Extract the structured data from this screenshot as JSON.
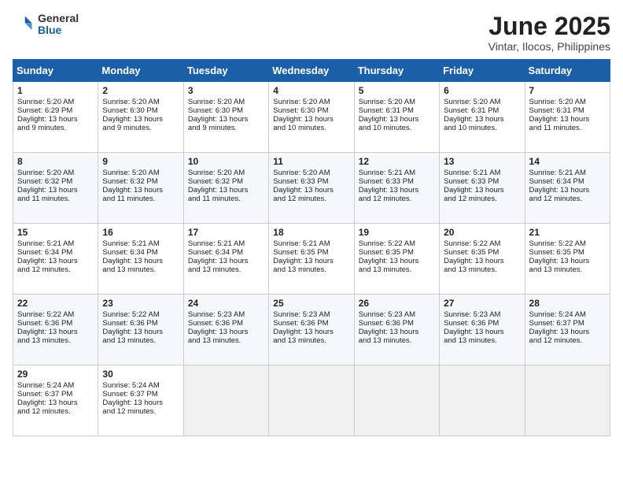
{
  "header": {
    "logo_general": "General",
    "logo_blue": "Blue",
    "month_title": "June 2025",
    "location": "Vintar, Ilocos, Philippines"
  },
  "calendar": {
    "days_of_week": [
      "Sunday",
      "Monday",
      "Tuesday",
      "Wednesday",
      "Thursday",
      "Friday",
      "Saturday"
    ],
    "weeks": [
      [
        null,
        null,
        null,
        null,
        {
          "day": 1,
          "sunrise": "5:20 AM",
          "sunset": "6:29 PM",
          "daylight": "13 hours and 9 minutes."
        },
        {
          "day": 2,
          "sunrise": "5:20 AM",
          "sunset": "6:30 PM",
          "daylight": "13 hours and 9 minutes."
        },
        {
          "day": 3,
          "sunrise": "5:20 AM",
          "sunset": "6:30 PM",
          "daylight": "13 hours and 9 minutes."
        },
        {
          "day": 4,
          "sunrise": "5:20 AM",
          "sunset": "6:30 PM",
          "daylight": "13 hours and 10 minutes."
        },
        {
          "day": 5,
          "sunrise": "5:20 AM",
          "sunset": "6:31 PM",
          "daylight": "13 hours and 10 minutes."
        },
        {
          "day": 6,
          "sunrise": "5:20 AM",
          "sunset": "6:31 PM",
          "daylight": "13 hours and 10 minutes."
        },
        {
          "day": 7,
          "sunrise": "5:20 AM",
          "sunset": "6:31 PM",
          "daylight": "13 hours and 11 minutes."
        }
      ],
      [
        {
          "day": 8,
          "sunrise": "5:20 AM",
          "sunset": "6:32 PM",
          "daylight": "13 hours and 11 minutes."
        },
        {
          "day": 9,
          "sunrise": "5:20 AM",
          "sunset": "6:32 PM",
          "daylight": "13 hours and 11 minutes."
        },
        {
          "day": 10,
          "sunrise": "5:20 AM",
          "sunset": "6:32 PM",
          "daylight": "13 hours and 11 minutes."
        },
        {
          "day": 11,
          "sunrise": "5:20 AM",
          "sunset": "6:33 PM",
          "daylight": "13 hours and 12 minutes."
        },
        {
          "day": 12,
          "sunrise": "5:21 AM",
          "sunset": "6:33 PM",
          "daylight": "13 hours and 12 minutes."
        },
        {
          "day": 13,
          "sunrise": "5:21 AM",
          "sunset": "6:33 PM",
          "daylight": "13 hours and 12 minutes."
        },
        {
          "day": 14,
          "sunrise": "5:21 AM",
          "sunset": "6:34 PM",
          "daylight": "13 hours and 12 minutes."
        }
      ],
      [
        {
          "day": 15,
          "sunrise": "5:21 AM",
          "sunset": "6:34 PM",
          "daylight": "13 hours and 12 minutes."
        },
        {
          "day": 16,
          "sunrise": "5:21 AM",
          "sunset": "6:34 PM",
          "daylight": "13 hours and 13 minutes."
        },
        {
          "day": 17,
          "sunrise": "5:21 AM",
          "sunset": "6:34 PM",
          "daylight": "13 hours and 13 minutes."
        },
        {
          "day": 18,
          "sunrise": "5:21 AM",
          "sunset": "6:35 PM",
          "daylight": "13 hours and 13 minutes."
        },
        {
          "day": 19,
          "sunrise": "5:22 AM",
          "sunset": "6:35 PM",
          "daylight": "13 hours and 13 minutes."
        },
        {
          "day": 20,
          "sunrise": "5:22 AM",
          "sunset": "6:35 PM",
          "daylight": "13 hours and 13 minutes."
        },
        {
          "day": 21,
          "sunrise": "5:22 AM",
          "sunset": "6:35 PM",
          "daylight": "13 hours and 13 minutes."
        }
      ],
      [
        {
          "day": 22,
          "sunrise": "5:22 AM",
          "sunset": "6:36 PM",
          "daylight": "13 hours and 13 minutes."
        },
        {
          "day": 23,
          "sunrise": "5:22 AM",
          "sunset": "6:36 PM",
          "daylight": "13 hours and 13 minutes."
        },
        {
          "day": 24,
          "sunrise": "5:23 AM",
          "sunset": "6:36 PM",
          "daylight": "13 hours and 13 minutes."
        },
        {
          "day": 25,
          "sunrise": "5:23 AM",
          "sunset": "6:36 PM",
          "daylight": "13 hours and 13 minutes."
        },
        {
          "day": 26,
          "sunrise": "5:23 AM",
          "sunset": "6:36 PM",
          "daylight": "13 hours and 13 minutes."
        },
        {
          "day": 27,
          "sunrise": "5:23 AM",
          "sunset": "6:36 PM",
          "daylight": "13 hours and 13 minutes."
        },
        {
          "day": 28,
          "sunrise": "5:24 AM",
          "sunset": "6:37 PM",
          "daylight": "13 hours and 12 minutes."
        }
      ],
      [
        {
          "day": 29,
          "sunrise": "5:24 AM",
          "sunset": "6:37 PM",
          "daylight": "13 hours and 12 minutes."
        },
        {
          "day": 30,
          "sunrise": "5:24 AM",
          "sunset": "6:37 PM",
          "daylight": "13 hours and 12 minutes."
        },
        null,
        null,
        null,
        null,
        null
      ]
    ]
  }
}
